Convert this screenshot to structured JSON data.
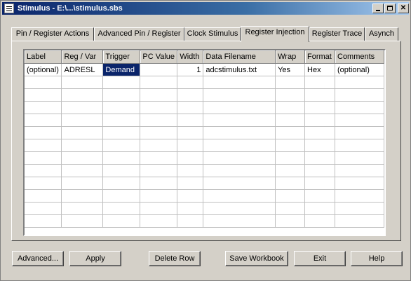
{
  "window": {
    "title": "Stimulus - E:\\...\\stimulus.sbs"
  },
  "tabs": [
    {
      "label": "Pin / Register Actions",
      "active": false
    },
    {
      "label": "Advanced Pin / Register",
      "active": false
    },
    {
      "label": "Clock Stimulus",
      "active": false
    },
    {
      "label": "Register Injection",
      "active": true
    },
    {
      "label": "Register Trace",
      "active": false
    },
    {
      "label": "Asynch",
      "active": false
    }
  ],
  "grid": {
    "columns": [
      "Label",
      "Reg / Var",
      "Trigger",
      "PC Value",
      "Width",
      "Data Filename",
      "Wrap",
      "Format",
      "Comments"
    ],
    "rows": [
      [
        "(optional)",
        "ADRESL",
        "Demand",
        "",
        "1",
        "adcstimulus.txt",
        "Yes",
        "Hex",
        "(optional)"
      ]
    ],
    "selected_cell": {
      "row": 0,
      "col": 2
    }
  },
  "buttons": {
    "advanced": "Advanced...",
    "apply": "Apply",
    "delete_row": "Delete Row",
    "save_workbook": "Save Workbook",
    "exit": "Exit",
    "help": "Help"
  },
  "colors": {
    "titlebar": "#0a246a",
    "selection": "#0a246a",
    "face": "#d4d0c8"
  }
}
